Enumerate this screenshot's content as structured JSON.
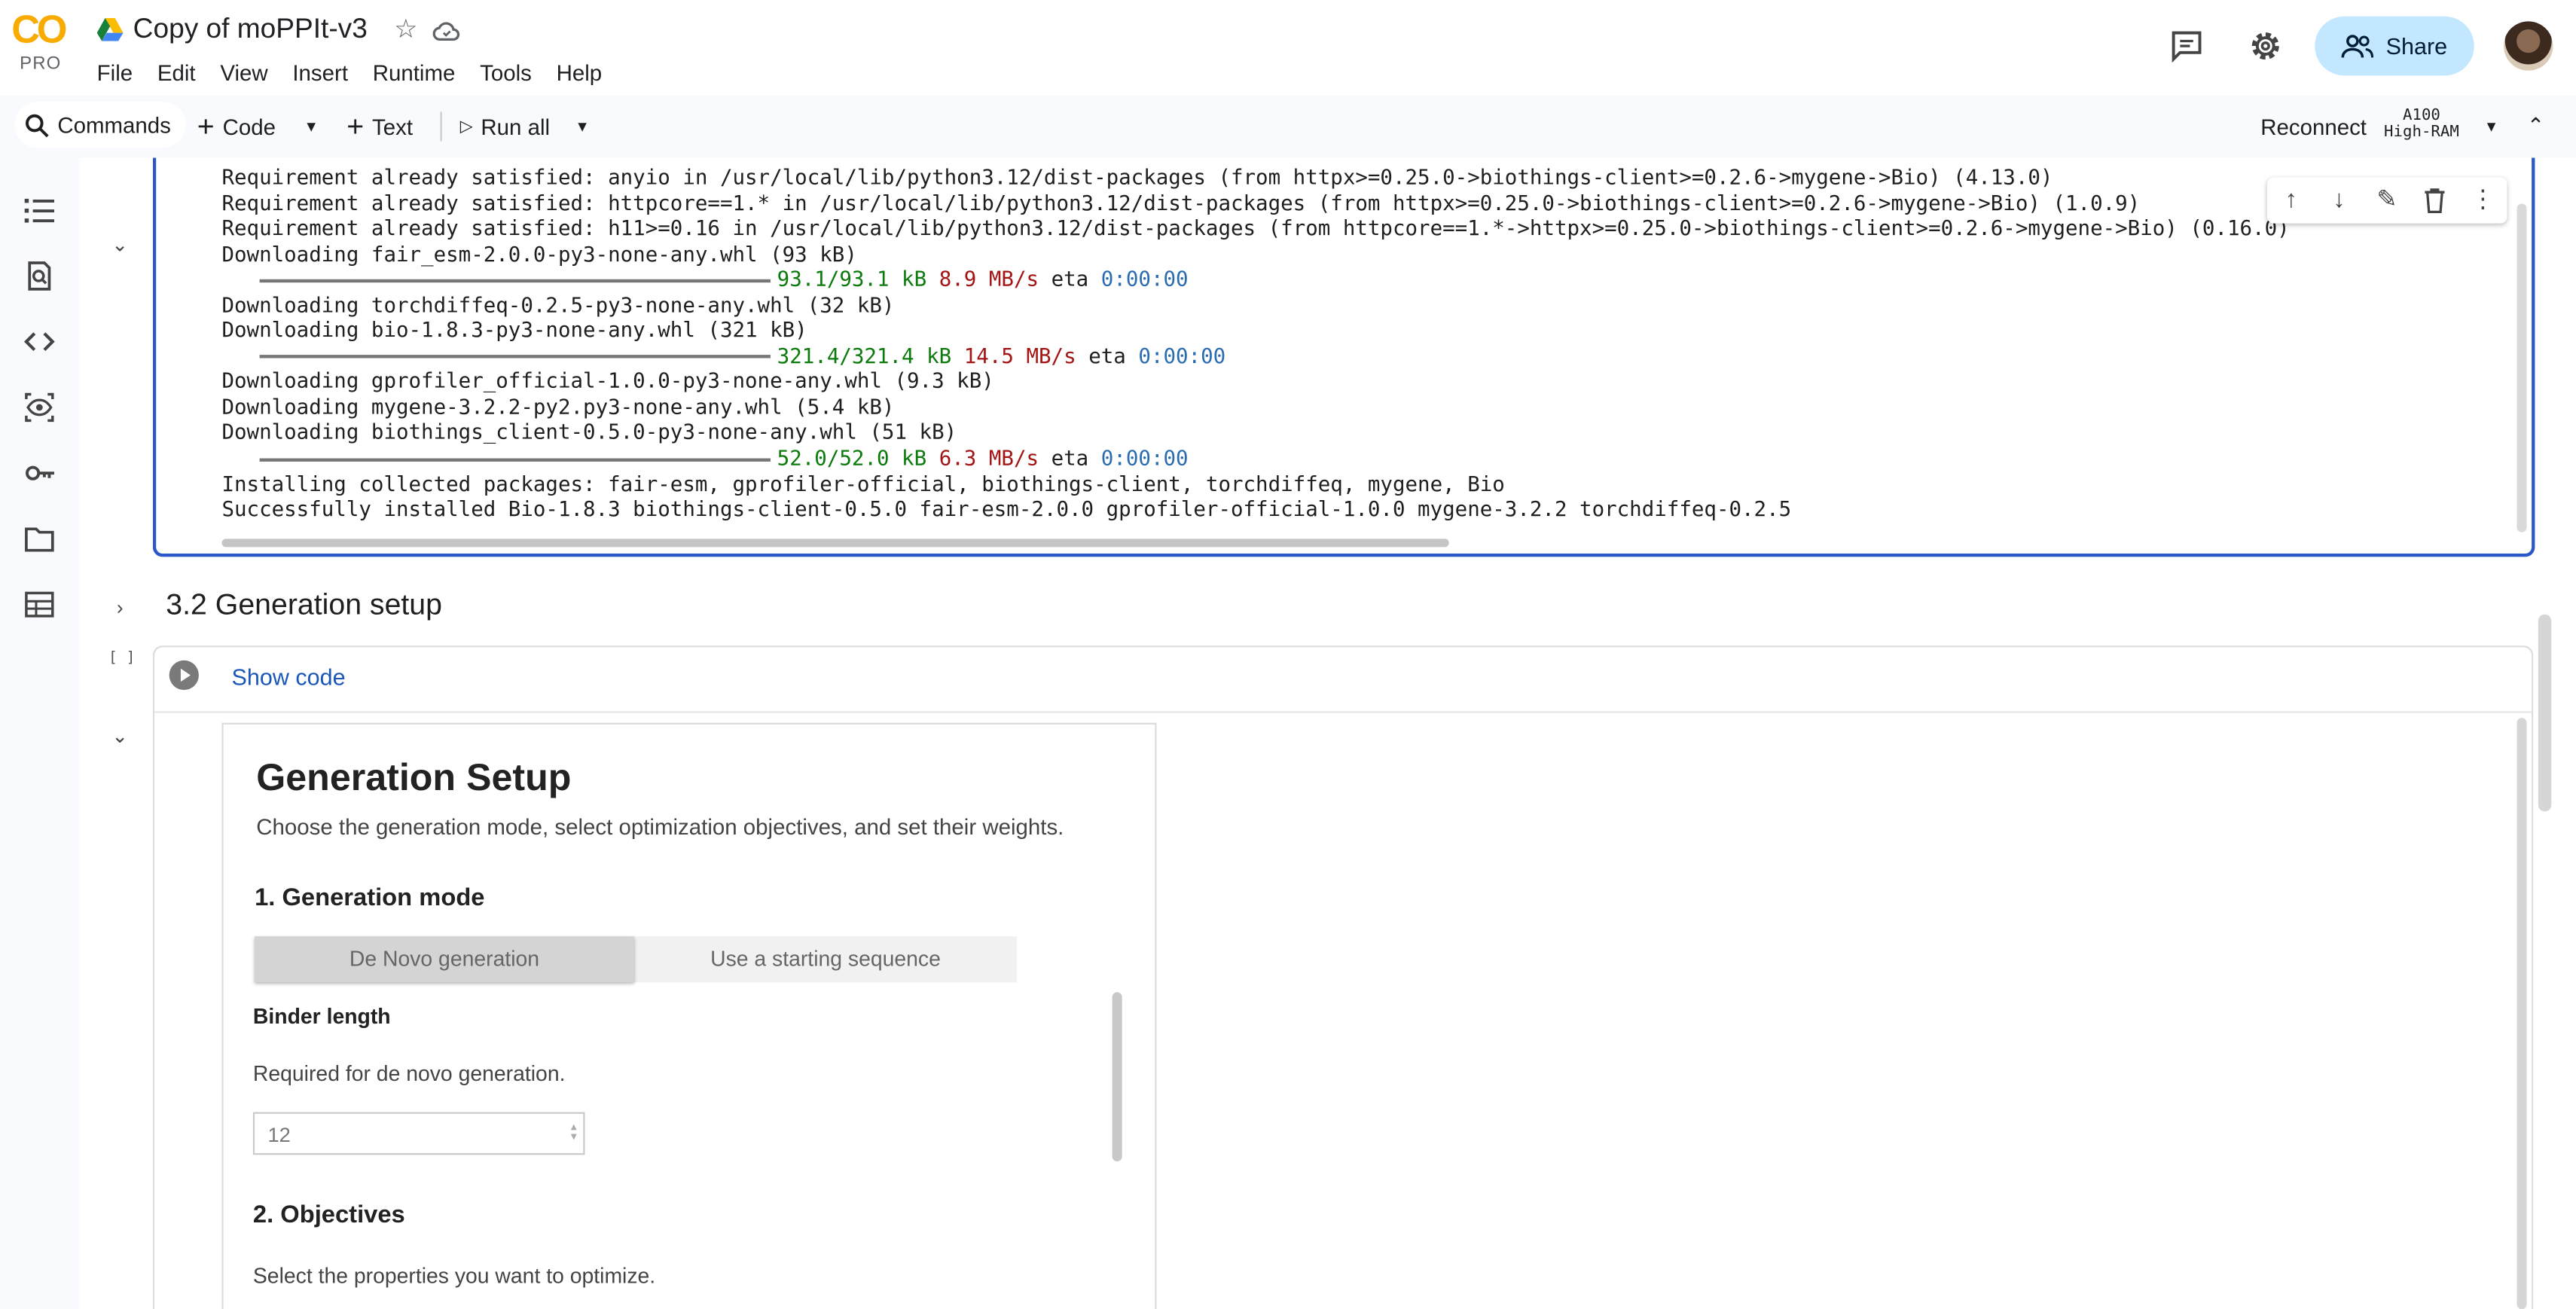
{
  "app": {
    "logo": "CO",
    "tier": "PRO",
    "title": "Copy of moPPIt-v3"
  },
  "menu": [
    "File",
    "Edit",
    "View",
    "Insert",
    "Runtime",
    "Tools",
    "Help"
  ],
  "header": {
    "share_label": "Share"
  },
  "toolbar": {
    "commands": "Commands",
    "code": "Code",
    "text": "Text",
    "run_all": "Run all",
    "reconnect": "Reconnect",
    "runtime_gpu": "A100",
    "runtime_ram": "High-RAM"
  },
  "output": {
    "lines": [
      "Requirement already satisfied: anyio in /usr/local/lib/python3.12/dist-packages (from httpx>=0.25.0->biothings-client>=0.2.6->mygene->Bio) (4.13.0)",
      "Requirement already satisfied: httpcore==1.* in /usr/local/lib/python3.12/dist-packages (from httpx>=0.25.0->biothings-client>=0.2.6->mygene->Bio) (1.0.9)",
      "Requirement already satisfied: h11>=0.16 in /usr/local/lib/python3.12/dist-packages (from httpcore==1.*->httpx>=0.25.0->biothings-client>=0.2.6->mygene->Bio) (0.16.0)",
      "Downloading fair_esm-2.0.0-py3-none-any.whl (93 kB)"
    ],
    "p1": {
      "size": "93.1/93.1 kB",
      "speed": "8.9 MB/s",
      "eta_label": "eta",
      "eta": "0:00:00"
    },
    "lines2": [
      "Downloading torchdiffeq-0.2.5-py3-none-any.whl (32 kB)",
      "Downloading bio-1.8.3-py3-none-any.whl (321 kB)"
    ],
    "p2": {
      "size": "321.4/321.4 kB",
      "speed": "14.5 MB/s",
      "eta_label": "eta",
      "eta": "0:00:00"
    },
    "lines3": [
      "Downloading gprofiler_official-1.0.0-py3-none-any.whl (9.3 kB)",
      "Downloading mygene-3.2.2-py2.py3-none-any.whl (5.4 kB)",
      "Downloading biothings_client-0.5.0-py3-none-any.whl (51 kB)"
    ],
    "p3": {
      "size": "52.0/52.0 kB",
      "speed": "6.3 MB/s",
      "eta_label": "eta",
      "eta": "0:00:00"
    },
    "lines4": [
      "Installing collected packages: fair-esm, gprofiler-official, biothings-client, torchdiffeq, mygene, Bio",
      "Successfully installed Bio-1.8.3 biothings-client-0.5.0 fair-esm-2.0.0 gprofiler-official-1.0.0 mygene-3.2.2 torchdiffeq-0.2.5"
    ]
  },
  "section": {
    "title": "3.2 Generation setup"
  },
  "cell": {
    "exec_count": "[ ]",
    "show_code": "Show code"
  },
  "form": {
    "title": "Generation Setup",
    "subtitle": "Choose the generation mode, select optimization objectives, and set their weights.",
    "mode_heading": "1. Generation mode",
    "mode_options": [
      "De Novo generation",
      "Use a starting sequence"
    ],
    "mode_selected": "De Novo generation",
    "binder_label": "Binder length",
    "binder_help": "Required for de novo generation.",
    "binder_value": "12",
    "objectives_heading": "2. Objectives",
    "objectives_help": "Select the properties you want to optimize."
  }
}
